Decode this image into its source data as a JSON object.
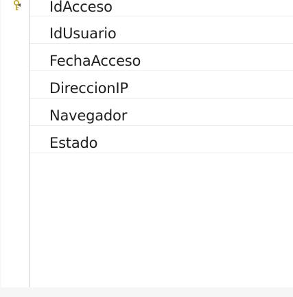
{
  "columns": [
    {
      "name": "IdAcceso",
      "primary_key": true,
      "selected": true
    },
    {
      "name": "IdUsuario",
      "primary_key": false,
      "selected": false
    },
    {
      "name": "FechaAcceso",
      "primary_key": false,
      "selected": false
    },
    {
      "name": "DireccionIP",
      "primary_key": false,
      "selected": false
    },
    {
      "name": "Navegador",
      "primary_key": false,
      "selected": false
    },
    {
      "name": "Estado",
      "primary_key": false,
      "selected": false
    }
  ],
  "icons": {
    "row_indicator": "row-selector-arrow-icon",
    "key": "primary-key-icon"
  },
  "colors": {
    "key_gold": "#c8a52a",
    "text": "#1e1e1e"
  }
}
